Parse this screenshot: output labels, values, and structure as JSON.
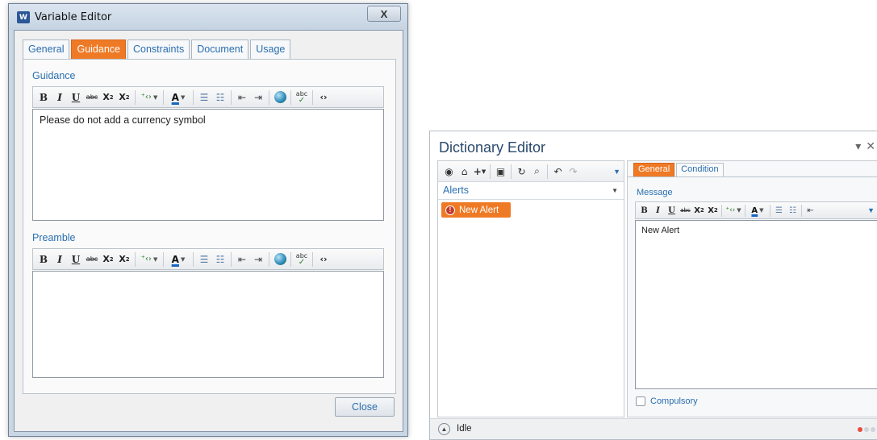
{
  "variable_editor": {
    "title": "Variable Editor",
    "app_icon_text": "W",
    "close_glyph": "X",
    "tabs": [
      {
        "label": "General",
        "active": false
      },
      {
        "label": "Guidance",
        "active": true
      },
      {
        "label": "Constraints",
        "active": false
      },
      {
        "label": "Document",
        "active": false
      },
      {
        "label": "Usage",
        "active": false
      }
    ],
    "guidance": {
      "label": "Guidance",
      "content": "Please do not add a currency symbol"
    },
    "preamble": {
      "label": "Preamble",
      "content": ""
    },
    "close_button": "Close"
  },
  "toolbar_icons": [
    "bold-icon",
    "italic-icon",
    "underline-icon",
    "strikethrough-icon",
    "subscript-icon",
    "superscript-icon",
    "insert-field-icon",
    "font-color-icon",
    "bullet-list-icon",
    "numbered-list-icon",
    "decrease-indent-icon",
    "increase-indent-icon",
    "hyperlink-icon",
    "spellcheck-icon",
    "html-source-icon"
  ],
  "dictionary_editor": {
    "title": "Dictionary Editor",
    "list_header": "Alerts",
    "items": [
      {
        "label": "New Alert",
        "badge": "!"
      }
    ],
    "tabs": [
      {
        "label": "General",
        "active": true
      },
      {
        "label": "Condition",
        "active": false
      }
    ],
    "message_label": "Message",
    "message_content": "New Alert",
    "compulsory_label": "Compulsory",
    "compulsory_checked": false,
    "status": "Idle"
  },
  "colors": {
    "accent_orange": "#ef7a26",
    "link_blue": "#2a6fb0",
    "status_dot_active": "#e74c3c"
  }
}
